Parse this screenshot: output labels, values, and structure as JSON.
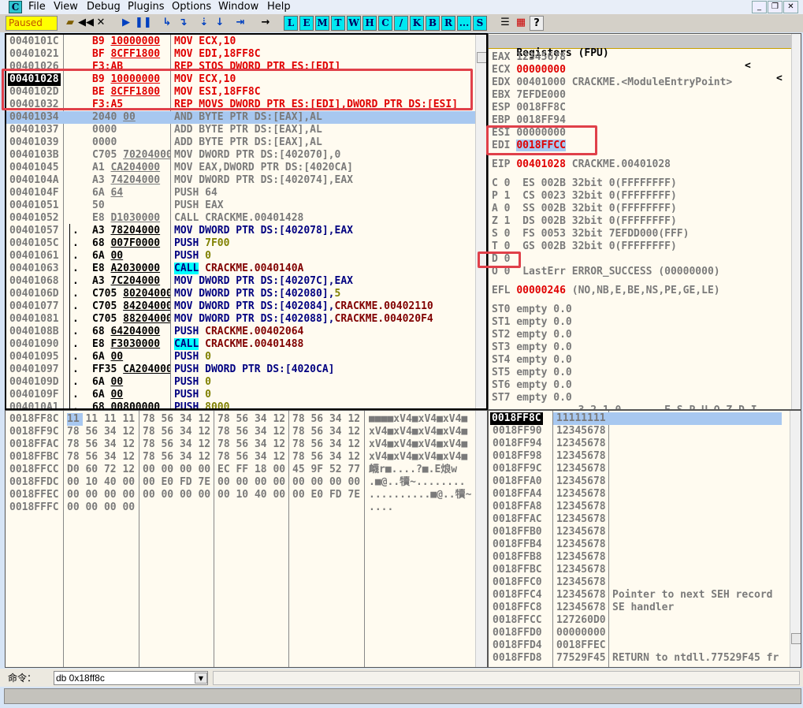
{
  "menu": {
    "app_icon": "C",
    "items": [
      "File",
      "View",
      "Debug",
      "Plugins",
      "Options",
      "Window",
      "Help"
    ]
  },
  "window_controls": [
    "minimize",
    "restore",
    "close"
  ],
  "toolbar": {
    "status": "Paused",
    "icons": [
      "open-icon",
      "restart-icon",
      "close-icon",
      "run-icon",
      "pause-icon",
      "step-into-icon",
      "step-over-icon",
      "trace-into-icon",
      "trace-over-icon",
      "execute-till-return-icon",
      "goto-icon"
    ],
    "letter_buttons": [
      "L",
      "E",
      "M",
      "T",
      "W",
      "H",
      "C",
      "/",
      "K",
      "B",
      "R",
      "...",
      "S"
    ],
    "right_icons": [
      "list-icon",
      "colors-icon",
      "help-icon"
    ],
    "help_label": "?"
  },
  "colors": {
    "red": "#e00000",
    "navy": "#000080",
    "dark_red": "#800000",
    "olive": "#808000",
    "call_highlight": "#00ffff",
    "selection": "#a8c8f0",
    "annotation": "#e0404a",
    "pane_bg": "#fffbf0"
  },
  "disassembly": {
    "current_address": "00401028",
    "rows": [
      {
        "addr": "0040101C",
        "m": "",
        "op": "B9",
        "arg": "10000000",
        "ins": [
          [
            "MOV ECX,10",
            "r"
          ]
        ]
      },
      {
        "addr": "00401021",
        "m": "",
        "op": "BF",
        "arg": "8CFF1800",
        "ins": [
          [
            "MOV EDI,18FF8C",
            "r"
          ]
        ]
      },
      {
        "addr": "00401026",
        "m": "",
        "op": "F3:AB",
        "arg": "",
        "ins": [
          [
            "REP STOS DWORD PTR ES:[EDI]",
            "r"
          ]
        ]
      },
      {
        "addr": "00401028",
        "m": "",
        "op": "B9",
        "arg": "10000000",
        "ins": [
          [
            "MOV ECX,10",
            "r"
          ]
        ],
        "current": true
      },
      {
        "addr": "0040102D",
        "m": "",
        "op": "BE",
        "arg": "8CFF1800",
        "ins": [
          [
            "MOV ESI,18FF8C",
            "r"
          ]
        ]
      },
      {
        "addr": "00401032",
        "m": "",
        "op": "F3:A5",
        "arg": "",
        "ins": [
          [
            "REP MOVS DWORD PTR ES:[EDI],DWORD PTR DS:[ESI]",
            "r"
          ]
        ]
      },
      {
        "addr": "00401034",
        "m": "",
        "op": "2040",
        "arg": "00",
        "ins": [
          [
            "AND BYTE PTR DS:[EAX],AL",
            "g"
          ]
        ],
        "selected": true
      },
      {
        "addr": "00401037",
        "m": "",
        "op": "0000",
        "arg": "",
        "ins": [
          [
            "ADD BYTE PTR DS:[EAX],AL",
            "g"
          ]
        ]
      },
      {
        "addr": "00401039",
        "m": "",
        "op": "0000",
        "arg": "",
        "ins": [
          [
            "ADD BYTE PTR DS:[EAX],AL",
            "g"
          ]
        ]
      },
      {
        "addr": "0040103B",
        "m": "",
        "op": "C705",
        "arg": "70204000",
        "ins": [
          [
            "MOV DWORD PTR DS:[402070],0",
            "g"
          ]
        ]
      },
      {
        "addr": "00401045",
        "m": "",
        "op": "A1",
        "arg": "CA204000",
        "ins": [
          [
            "MOV EAX,DWORD PTR DS:[4020CA]",
            "g"
          ]
        ]
      },
      {
        "addr": "0040104A",
        "m": "",
        "op": "A3",
        "arg": "74204000",
        "ins": [
          [
            "MOV DWORD PTR DS:[402074],EAX",
            "g"
          ]
        ]
      },
      {
        "addr": "0040104F",
        "m": "",
        "op": "6A",
        "arg": "64",
        "ins": [
          [
            "PUSH 64",
            "g"
          ]
        ]
      },
      {
        "addr": "00401051",
        "m": "",
        "op": "50",
        "arg": "",
        "ins": [
          [
            "PUSH EAX",
            "g"
          ]
        ]
      },
      {
        "addr": "00401052",
        "m": "",
        "op": "E8",
        "arg": "D1030000",
        "ins": [
          [
            "CALL CRACKME.00401428",
            "g"
          ]
        ]
      },
      {
        "addr": "00401057",
        "m": ".",
        "op": "A3",
        "arg": "78204000",
        "ins": [
          [
            "MOV DWORD PTR DS:[402078],EAX",
            "n"
          ]
        ]
      },
      {
        "addr": "0040105C",
        "m": ".",
        "op": "68",
        "arg": "007F0000",
        "ins": [
          [
            "PUSH ",
            "n"
          ],
          [
            "7F00",
            "o"
          ]
        ]
      },
      {
        "addr": "00401061",
        "m": ".",
        "op": "6A",
        "arg": "00",
        "ins": [
          [
            "PUSH ",
            "n"
          ],
          [
            "0",
            "o"
          ]
        ]
      },
      {
        "addr": "00401063",
        "m": ".",
        "op": "E8",
        "arg": "A2030000",
        "ins": [
          [
            "CALL",
            "cy"
          ],
          [
            " CRACKME.0040140A",
            "dr"
          ]
        ]
      },
      {
        "addr": "00401068",
        "m": ".",
        "op": "A3",
        "arg": "7C204000",
        "ins": [
          [
            "MOV DWORD PTR DS:[40207C],EAX",
            "n"
          ]
        ]
      },
      {
        "addr": "0040106D",
        "m": ".",
        "op": "C705",
        "arg": "80204000",
        "ins": [
          [
            "MOV DWORD PTR DS:[402080],",
            "n"
          ],
          [
            "5",
            "o"
          ]
        ]
      },
      {
        "addr": "00401077",
        "m": ".",
        "op": "C705",
        "arg": "84204000",
        "ins": [
          [
            "MOV DWORD PTR DS:[402084],",
            "n"
          ],
          [
            "CRACKME.00402110",
            "dr"
          ]
        ]
      },
      {
        "addr": "00401081",
        "m": ".",
        "op": "C705",
        "arg": "88204000",
        "ins": [
          [
            "MOV DWORD PTR DS:[402088],",
            "n"
          ],
          [
            "CRACKME.004020F4",
            "dr"
          ]
        ]
      },
      {
        "addr": "0040108B",
        "m": ".",
        "op": "68",
        "arg": "64204000",
        "ins": [
          [
            "PUSH ",
            "n"
          ],
          [
            "CRACKME.00402064",
            "dr"
          ]
        ]
      },
      {
        "addr": "00401090",
        "m": ".",
        "op": "E8",
        "arg": "F3030000",
        "ins": [
          [
            "CALL",
            "cy"
          ],
          [
            " CRACKME.00401488",
            "dr"
          ]
        ]
      },
      {
        "addr": "00401095",
        "m": ".",
        "op": "6A",
        "arg": "00",
        "ins": [
          [
            "PUSH ",
            "n"
          ],
          [
            "0",
            "o"
          ]
        ]
      },
      {
        "addr": "00401097",
        "m": ".",
        "op": "FF35",
        "arg": "CA204000",
        "ins": [
          [
            "PUSH DWORD PTR DS:[4020CA]",
            "n"
          ]
        ]
      },
      {
        "addr": "0040109D",
        "m": ".",
        "op": "6A",
        "arg": "00",
        "ins": [
          [
            "PUSH ",
            "n"
          ],
          [
            "0",
            "o"
          ]
        ]
      },
      {
        "addr": "0040109F",
        "m": ".",
        "op": "6A",
        "arg": "00",
        "ins": [
          [
            "PUSH ",
            "n"
          ],
          [
            "0",
            "o"
          ]
        ]
      },
      {
        "addr": "004010A1",
        "m": ".",
        "op": "68",
        "arg": "00800000",
        "ins": [
          [
            "PUSH ",
            "n"
          ],
          [
            "8000",
            "o"
          ]
        ]
      }
    ]
  },
  "registers": {
    "title": "Registers (FPU)",
    "nav": [
      "<",
      "<"
    ],
    "general": [
      {
        "name": "EAX",
        "value": "12345678",
        "changed": false,
        "comment": ""
      },
      {
        "name": "ECX",
        "value": "00000000",
        "changed": true,
        "comment": ""
      },
      {
        "name": "EDX",
        "value": "00401000",
        "changed": false,
        "comment": "CRACKME.<ModuleEntryPoint>"
      },
      {
        "name": "EBX",
        "value": "7EFDE000",
        "changed": false,
        "comment": ""
      },
      {
        "name": "ESP",
        "value": "0018FF8C",
        "changed": false,
        "comment": ""
      },
      {
        "name": "EBP",
        "value": "0018FF94",
        "changed": false,
        "comment": ""
      },
      {
        "name": "ESI",
        "value": "00000000",
        "changed": false,
        "comment": ""
      },
      {
        "name": "EDI",
        "value": "0018FFCC",
        "changed": true,
        "comment": "",
        "selected": true
      }
    ],
    "eip": {
      "name": "EIP",
      "value": "00401028",
      "comment": "CRACKME.00401028"
    },
    "flags": [
      {
        "flag": "C",
        "bit": "0",
        "seg": "ES 002B 32bit 0(FFFFFFFF)"
      },
      {
        "flag": "P",
        "bit": "1",
        "seg": "CS 0023 32bit 0(FFFFFFFF)"
      },
      {
        "flag": "A",
        "bit": "0",
        "seg": "SS 002B 32bit 0(FFFFFFFF)"
      },
      {
        "flag": "Z",
        "bit": "1",
        "seg": "DS 002B 32bit 0(FFFFFFFF)"
      },
      {
        "flag": "S",
        "bit": "0",
        "seg": "FS 0053 32bit 7EFDD000(FFF)"
      },
      {
        "flag": "T",
        "bit": "0",
        "seg": "GS 002B 32bit 0(FFFFFFFF)"
      },
      {
        "flag": "D",
        "bit": "0",
        "seg": ""
      },
      {
        "flag": "O",
        "bit": "0",
        "seg": "LastErr ERROR_SUCCESS (00000000)"
      }
    ],
    "efl": {
      "name": "EFL",
      "value": "00000246",
      "comment": "(NO,NB,E,BE,NS,PE,GE,LE)"
    },
    "fpu": [
      "ST0 empty 0.0",
      "ST1 empty 0.0",
      "ST2 empty 0.0",
      "ST3 empty 0.0",
      "ST4 empty 0.0",
      "ST5 empty 0.0",
      "ST6 empty 0.0",
      "ST7 empty 0.0"
    ],
    "fpu_footer": "              3 2 1 0       E S P U O Z D I"
  },
  "dump": {
    "rows": [
      {
        "addr": "0018FF8C",
        "hex": [
          "11 11 11 11",
          "78 56 34 12",
          "78 56 34 12",
          "78 56 34 12"
        ],
        "ascii": "■■■■xV4■xV4■xV4■"
      },
      {
        "addr": "0018FF9C",
        "hex": [
          "78 56 34 12",
          "78 56 34 12",
          "78 56 34 12",
          "78 56 34 12"
        ],
        "ascii": "xV4■xV4■xV4■xV4■"
      },
      {
        "addr": "0018FFAC",
        "hex": [
          "78 56 34 12",
          "78 56 34 12",
          "78 56 34 12",
          "78 56 34 12"
        ],
        "ascii": "xV4■xV4■xV4■xV4■"
      },
      {
        "addr": "0018FFBC",
        "hex": [
          "78 56 34 12",
          "78 56 34 12",
          "78 56 34 12",
          "78 56 34 12"
        ],
        "ascii": "xV4■xV4■xV4■xV4■"
      },
      {
        "addr": "0018FFCC",
        "hex": [
          "D0 60 72 12",
          "00 00 00 00",
          "EC FF 18 00",
          "45 9F 52 77"
        ],
        "ascii": "衊r■....?■.E烺w"
      },
      {
        "addr": "0018FFDC",
        "hex": [
          "00 10 40 00",
          "00 E0 FD 7E",
          "00 00 00 00",
          "00 00 00 00"
        ],
        "ascii": ".■@..犢~........"
      },
      {
        "addr": "0018FFEC",
        "hex": [
          "00 00 00 00",
          "00 00 00 00",
          "00 10 40 00",
          "00 E0 FD 7E"
        ],
        "ascii": "..........■@..犢~"
      },
      {
        "addr": "0018FFFC",
        "hex": [
          "00 00 00 00",
          "",
          "",
          ""
        ],
        "ascii": "...."
      }
    ]
  },
  "stack": {
    "rows": [
      {
        "addr": "0018FF8C",
        "value": "11111111",
        "comment": "",
        "top": true
      },
      {
        "addr": "0018FF90",
        "value": "12345678",
        "comment": ""
      },
      {
        "addr": "0018FF94",
        "value": "12345678",
        "comment": ""
      },
      {
        "addr": "0018FF98",
        "value": "12345678",
        "comment": ""
      },
      {
        "addr": "0018FF9C",
        "value": "12345678",
        "comment": ""
      },
      {
        "addr": "0018FFA0",
        "value": "12345678",
        "comment": ""
      },
      {
        "addr": "0018FFA4",
        "value": "12345678",
        "comment": ""
      },
      {
        "addr": "0018FFA8",
        "value": "12345678",
        "comment": ""
      },
      {
        "addr": "0018FFAC",
        "value": "12345678",
        "comment": ""
      },
      {
        "addr": "0018FFB0",
        "value": "12345678",
        "comment": ""
      },
      {
        "addr": "0018FFB4",
        "value": "12345678",
        "comment": ""
      },
      {
        "addr": "0018FFB8",
        "value": "12345678",
        "comment": ""
      },
      {
        "addr": "0018FFBC",
        "value": "12345678",
        "comment": ""
      },
      {
        "addr": "0018FFC0",
        "value": "12345678",
        "comment": ""
      },
      {
        "addr": "0018FFC4",
        "value": "12345678",
        "comment": "Pointer to next SEH record"
      },
      {
        "addr": "0018FFC8",
        "value": "12345678",
        "comment": "SE handler"
      },
      {
        "addr": "0018FFCC",
        "value": "127260D0",
        "comment": ""
      },
      {
        "addr": "0018FFD0",
        "value": "00000000",
        "comment": ""
      },
      {
        "addr": "0018FFD4",
        "value": "0018FFEC",
        "comment": ""
      },
      {
        "addr": "0018FFD8",
        "value": "77529F45",
        "comment": "RETURN to ntdll.77529F45 fr"
      }
    ]
  },
  "command": {
    "label": "命令：",
    "value": "db 0x18ff8c"
  }
}
